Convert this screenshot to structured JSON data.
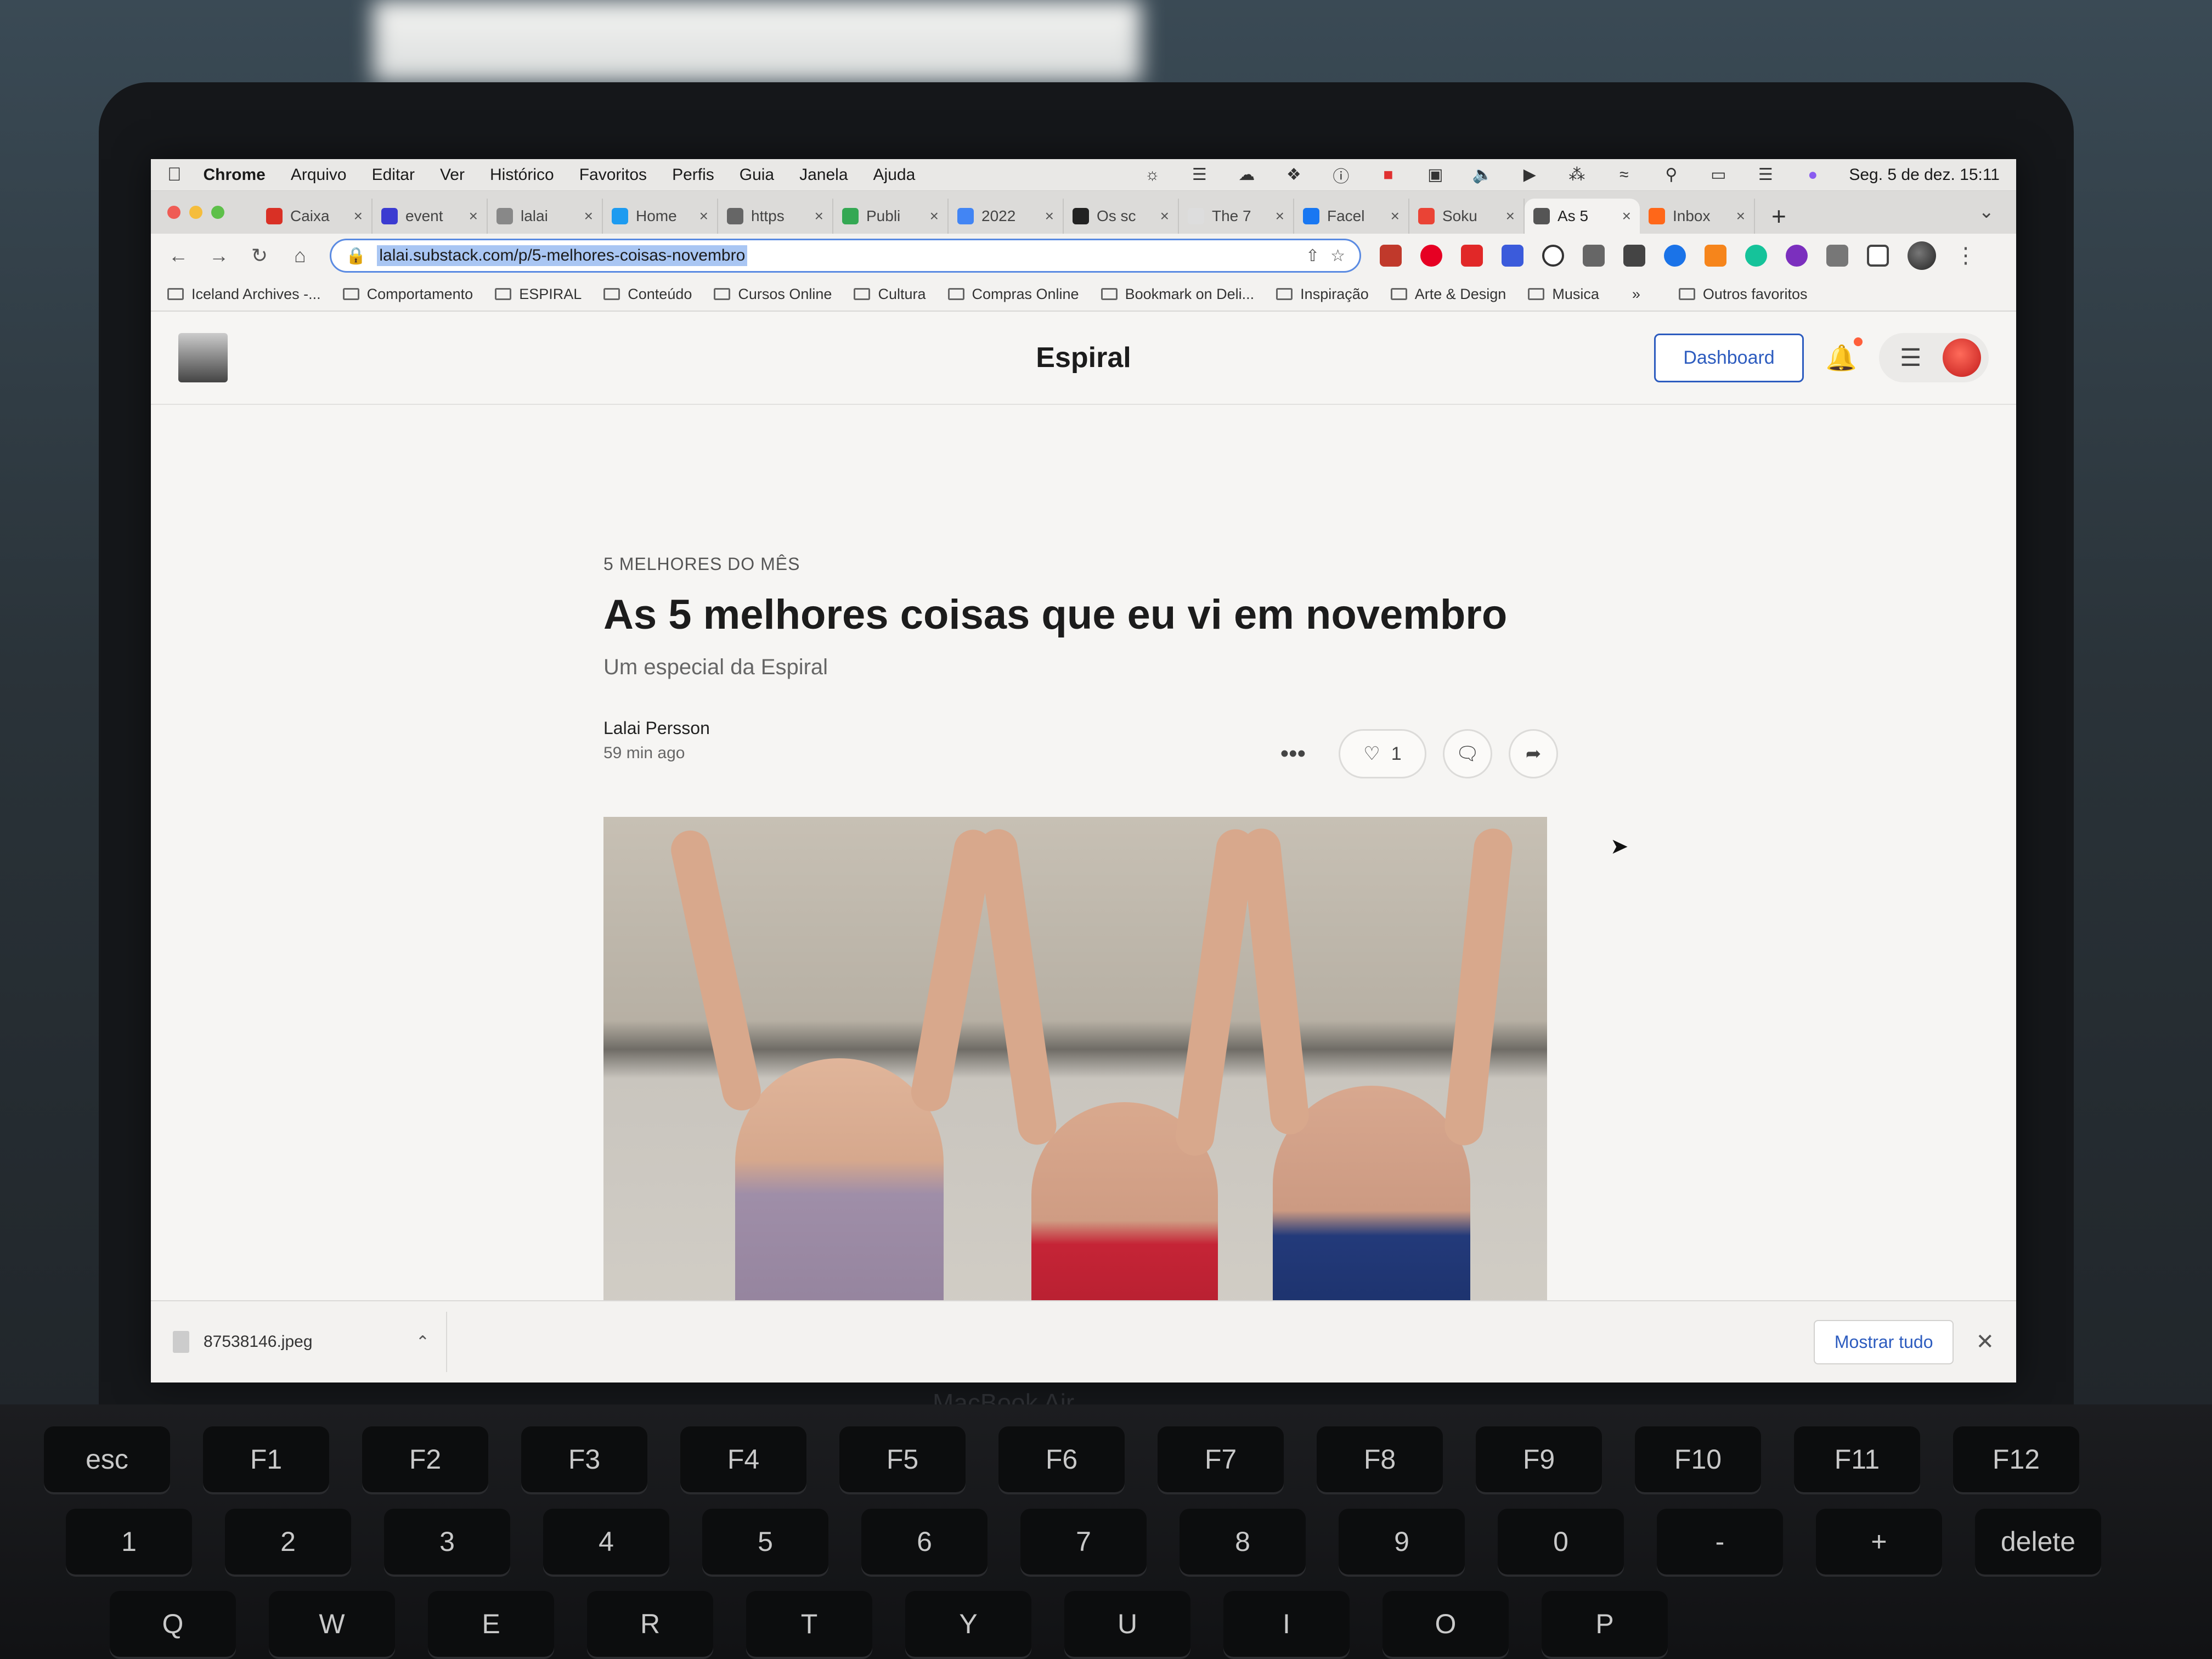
{
  "menubar": {
    "app_name": "Chrome",
    "items": [
      "Arquivo",
      "Editar",
      "Ver",
      "Histórico",
      "Favoritos",
      "Perfis",
      "Guia",
      "Janela",
      "Ajuda"
    ],
    "clock": "Seg. 5 de dez.  15:11"
  },
  "tabs": [
    {
      "title": "Caixa",
      "color": "#d93025"
    },
    {
      "title": "event",
      "color": "#3b3bd1"
    },
    {
      "title": "lalai",
      "color": "#888888"
    },
    {
      "title": "Home",
      "color": "#1d9bf0"
    },
    {
      "title": "https",
      "color": "#666666"
    },
    {
      "title": "Publi",
      "color": "#34a853"
    },
    {
      "title": "2022",
      "color": "#4285f4"
    },
    {
      "title": "Os sc",
      "color": "#222222"
    },
    {
      "title": "The 7",
      "color": "#dddddd"
    },
    {
      "title": "Facel",
      "color": "#1877f2"
    },
    {
      "title": "Soku",
      "color": "#ea4335"
    },
    {
      "title": "As 5",
      "color": "#555555",
      "active": true
    },
    {
      "title": "Inbox",
      "color": "#ff6719"
    }
  ],
  "address_bar": {
    "url": "lalai.substack.com/p/5-melhores-coisas-novembro"
  },
  "bookmarks": [
    "Iceland Archives -...",
    "Comportamento",
    "ESPIRAL",
    "Conteúdo",
    "Cursos Online",
    "Cultura",
    "Compras Online",
    "Bookmark on Deli...",
    "Inspiração",
    "Arte & Design",
    "Musica"
  ],
  "bookmarks_more": "»",
  "bookmarks_other": "Outros favoritos",
  "site": {
    "publication_name": "Espiral",
    "dashboard_label": "Dashboard"
  },
  "article": {
    "section": "5 MELHORES DO MÊS",
    "title": "As 5 melhores coisas que eu vi em novembro",
    "subtitle": "Um especial da Espiral",
    "author": "Lalai Persson",
    "timestamp": "59 min ago",
    "like_count": "1"
  },
  "download": {
    "filename": "87538146.jpeg",
    "show_all_label": "Mostrar tudo"
  },
  "device": {
    "brand_label": "MacBook Air"
  },
  "keyboard_rows": [
    [
      "esc",
      "F1",
      "F2",
      "F3",
      "F4",
      "F5",
      "F6",
      "F7",
      "F8",
      "F9",
      "F10",
      "F11",
      "F12"
    ],
    [
      "1",
      "2",
      "3",
      "4",
      "5",
      "6",
      "7",
      "8",
      "9",
      "0",
      "-",
      "+",
      "delete"
    ],
    [
      "Q",
      "W",
      "E",
      "R",
      "T",
      "Y",
      "U",
      "I",
      "O",
      "P"
    ]
  ]
}
